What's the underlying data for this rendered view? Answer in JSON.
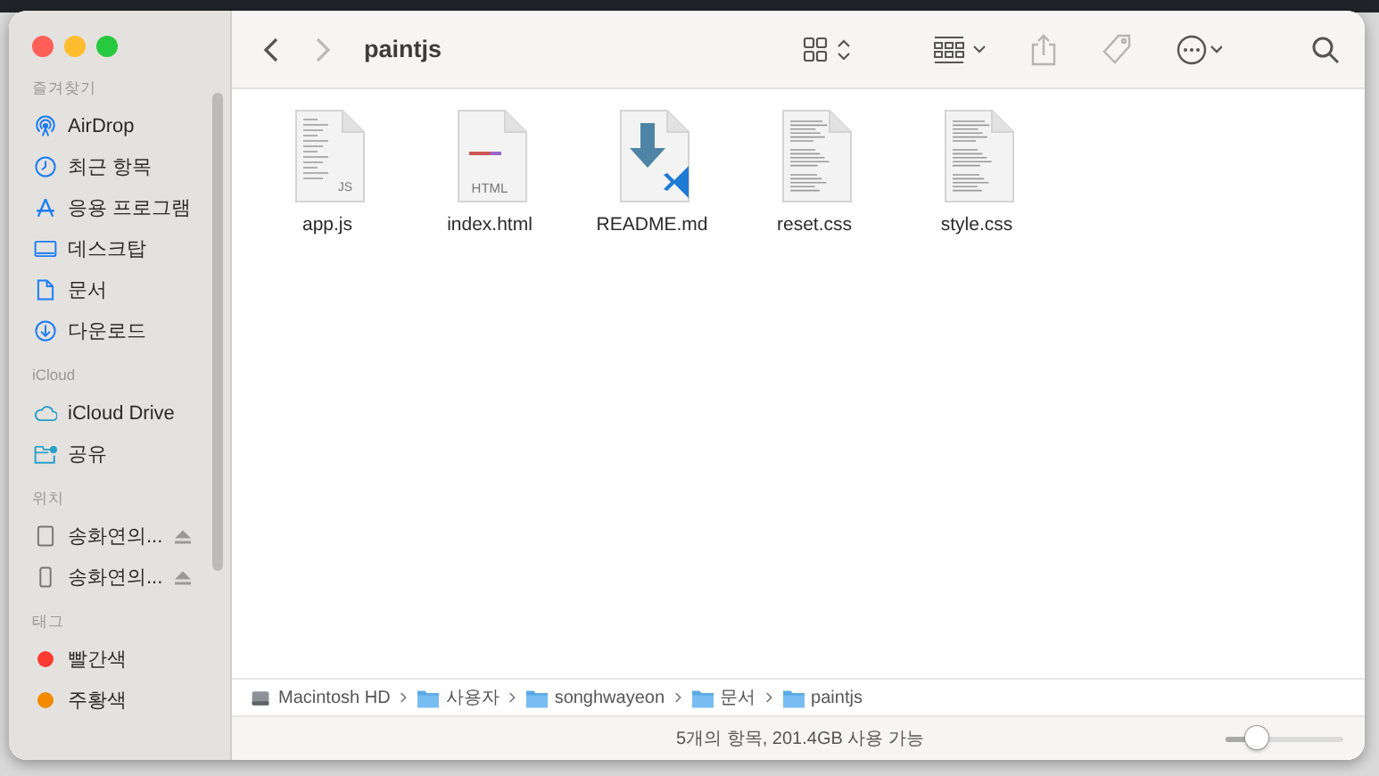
{
  "window": {
    "title": "paintjs"
  },
  "toolbar": {
    "back_enabled": true,
    "forward_enabled": false
  },
  "sidebar": {
    "sections": [
      {
        "header": "즐겨찾기",
        "items": [
          {
            "label": "AirDrop",
            "kind": "airdrop"
          },
          {
            "label": "최근 항목",
            "kind": "recent"
          },
          {
            "label": "응용 프로그램",
            "kind": "apps"
          },
          {
            "label": "데스크탑",
            "kind": "desktop"
          },
          {
            "label": "문서",
            "kind": "document"
          },
          {
            "label": "다운로드",
            "kind": "download"
          }
        ]
      },
      {
        "header": "iCloud",
        "items": [
          {
            "label": "iCloud Drive",
            "kind": "cloud"
          },
          {
            "label": "공유",
            "kind": "shared"
          }
        ]
      },
      {
        "header": "위치",
        "items": [
          {
            "label": "송화연의...",
            "kind": "ipad",
            "ejectable": true
          },
          {
            "label": "송화연의...",
            "kind": "iphone",
            "ejectable": true
          }
        ]
      },
      {
        "header": "태그",
        "items": [
          {
            "label": "빨간색",
            "kind": "tag",
            "color": "#fb3b30"
          },
          {
            "label": "주황색",
            "kind": "tag",
            "color": "#f38a00"
          }
        ]
      }
    ]
  },
  "files": [
    {
      "name": "app.js",
      "kind": "code",
      "badge": "JS"
    },
    {
      "name": "index.html",
      "kind": "html",
      "badge": "HTML"
    },
    {
      "name": "README.md",
      "kind": "markdown"
    },
    {
      "name": "reset.css",
      "kind": "text"
    },
    {
      "name": "style.css",
      "kind": "text"
    }
  ],
  "path_bar": [
    {
      "label": "Macintosh HD",
      "kind": "disk"
    },
    {
      "label": "사용자",
      "kind": "folder"
    },
    {
      "label": "songhwayeon",
      "kind": "folder"
    },
    {
      "label": "문서",
      "kind": "folder"
    },
    {
      "label": "paintjs",
      "kind": "folder"
    }
  ],
  "status_bar": {
    "text": "5개의 항목, 201.4GB 사용 가능",
    "icon_size": {
      "level": 0.27
    }
  }
}
